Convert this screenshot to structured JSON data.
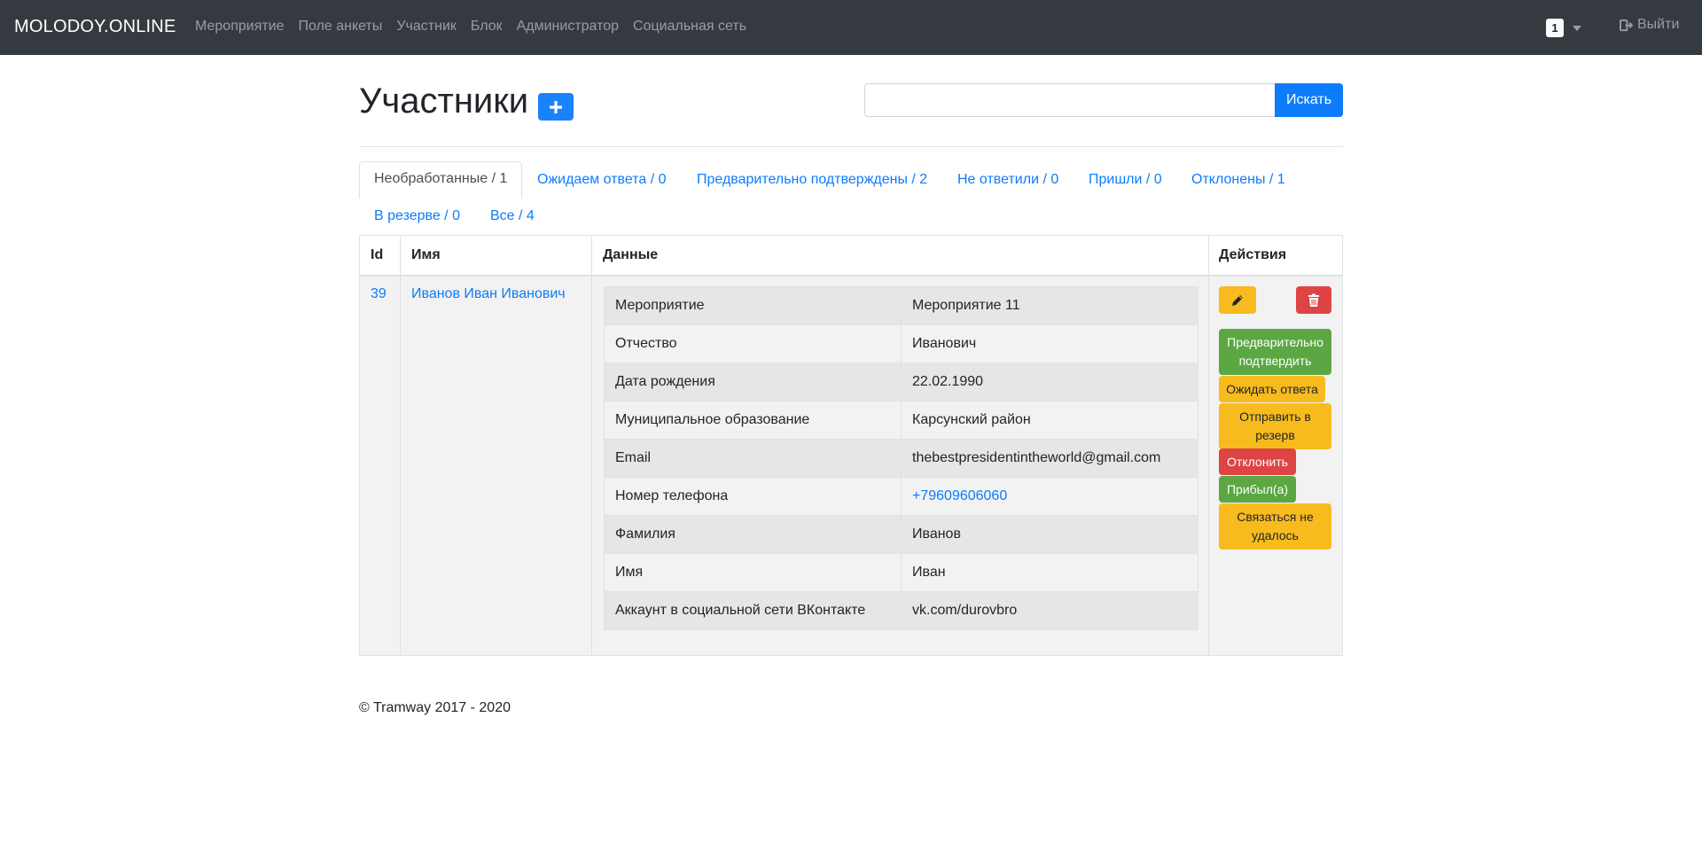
{
  "navbar": {
    "brand": "MOLODOY.ONLINE",
    "links": [
      "Мероприятие",
      "Поле анкеты",
      "Участник",
      "Блок",
      "Администратор",
      "Социальная сеть"
    ],
    "badge": "1",
    "logout": "Выйти"
  },
  "header": {
    "title": "Участники",
    "search_value": "",
    "search_button": "Искать"
  },
  "tabs": [
    {
      "label": "Необработанные / 1",
      "active": true
    },
    {
      "label": "Ожидаем ответа / 0",
      "active": false
    },
    {
      "label": "Предварительно подтверждены / 2",
      "active": false
    },
    {
      "label": "Не ответили / 0",
      "active": false
    },
    {
      "label": "Пришли / 0",
      "active": false
    },
    {
      "label": "Отклонены / 1",
      "active": false
    },
    {
      "label": "В резерве / 0",
      "active": false
    },
    {
      "label": "Все / 4",
      "active": false
    }
  ],
  "table": {
    "columns": [
      "Id",
      "Имя",
      "Данные",
      "Действия"
    ],
    "rows": [
      {
        "id": "39",
        "name": "Иванов Иван Иванович",
        "data": [
          {
            "key": "Мероприятие",
            "value": "Мероприятие 11"
          },
          {
            "key": "Отчество",
            "value": "Иванович"
          },
          {
            "key": "Дата рождения",
            "value": "22.02.1990"
          },
          {
            "key": "Муниципальное образование",
            "value": "Карсунский район"
          },
          {
            "key": "Email",
            "value": "thebestpresidentintheworld@gmail.com"
          },
          {
            "key": "Номер телефона",
            "value": "+79609606060"
          },
          {
            "key": "Фамилия",
            "value": "Иванов"
          },
          {
            "key": "Имя",
            "value": "Иван"
          },
          {
            "key": "Аккаунт в социальной сети ВКонтакте",
            "value": "vk.com/durovbro"
          }
        ],
        "actions": {
          "preconfirm": "Предварительно подтвердить",
          "await": "Ожидать ответа",
          "reserve": "Отправить в резерв",
          "decline": "Отклонить",
          "arrived": "Прибыл(а)",
          "no_contact": "Связаться не удалось"
        }
      }
    ]
  },
  "footer": "© Tramway 2017 - 2020",
  "colors": {
    "navbar": "#343a40",
    "primary": "#0d7cfb",
    "warning": "#f8bb1e",
    "success": "#5ba744",
    "danger": "#de4444"
  },
  "icons": [
    "plus-icon",
    "pencil-icon",
    "trash-icon",
    "sign-out-icon",
    "caret-down-icon"
  ]
}
